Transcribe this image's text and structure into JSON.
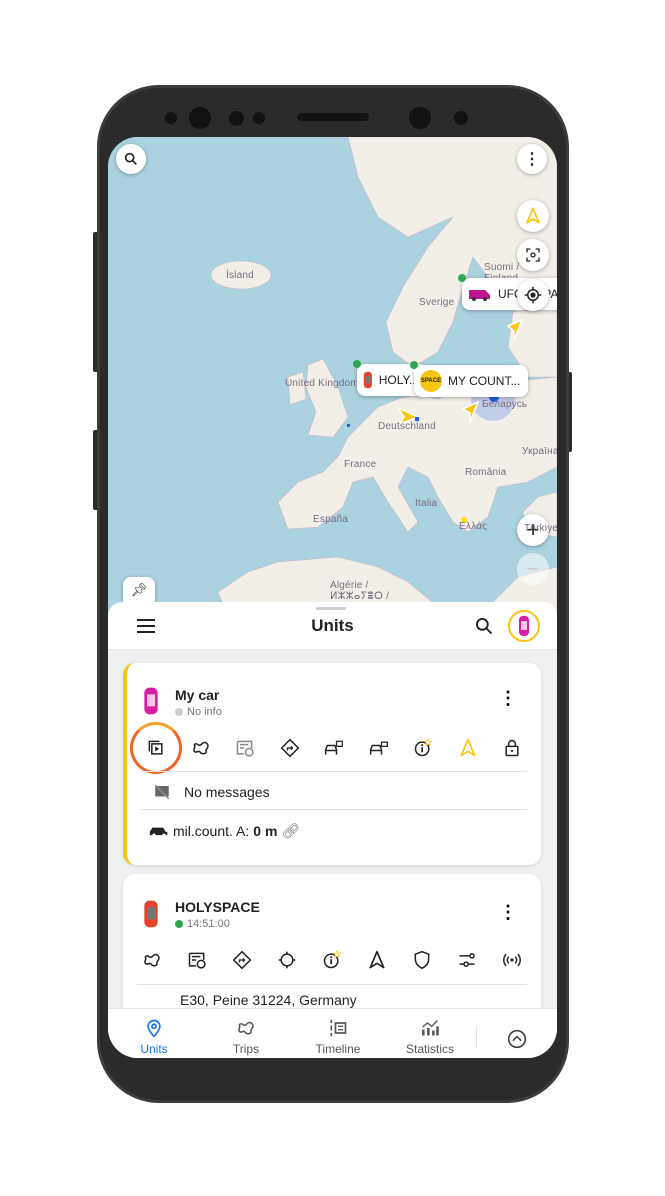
{
  "colors": {
    "accent": "#1a73e8",
    "selected_border": "#f9c513",
    "online": "#2ea84f",
    "offline": "#cccccc",
    "sea": "#aad3df",
    "land": "#f2efe9"
  },
  "map": {
    "labels": [
      "Ísland",
      "Sverige",
      "Suomi / Finland",
      "United Kingdom",
      "Deutschland",
      "Беларусь",
      "France",
      "România",
      "Україна",
      "Italia",
      "España",
      "Ελλάς",
      "Türkiye",
      "Algérie / ⵍⵣⵣⴰⵢⴻⵔ /"
    ],
    "markers": [
      {
        "name": "UFOINSPA...",
        "icon": "van-icon",
        "status": "online"
      },
      {
        "name": "HOLY...",
        "icon": "car-icon",
        "status": "online"
      },
      {
        "name": "MY COUNT...",
        "icon": "space-logo",
        "logo_text": "SPACE",
        "status": "online"
      }
    ],
    "buttons": {
      "search": "search-icon",
      "menu": "more-vert-icon",
      "navigate": "navigation-icon",
      "focus": "center-focus-icon",
      "locate": "my-location-icon",
      "zoom_in": "+",
      "zoom_out": "−",
      "pin": "pin-icon"
    }
  },
  "header": {
    "title": "Units",
    "menu_icon": "hamburger-icon",
    "search_icon": "search-icon"
  },
  "units": [
    {
      "name": "My car",
      "status": "No info",
      "status_type": "offline",
      "selected": true,
      "actions": [
        "messages-play",
        "trips",
        "reports-history",
        "route",
        "car-lock-1",
        "car-lock-2",
        "info-star",
        "navigation",
        "lock"
      ],
      "messages": "No messages",
      "counter_label": "mil.count. A:",
      "counter_value": "0 m"
    },
    {
      "name": "HOLYSPACE",
      "status": "14:51:00",
      "status_type": "online",
      "selected": false,
      "actions": [
        "trips",
        "reports-history",
        "route",
        "locate",
        "info-star",
        "navigation",
        "shield",
        "sliders",
        "signal"
      ],
      "address": "E30, Peine 31224, Germany"
    }
  ],
  "bottom_nav": {
    "items": [
      {
        "label": "Units",
        "active": true
      },
      {
        "label": "Trips"
      },
      {
        "label": "Timeline"
      },
      {
        "label": "Statistics"
      }
    ],
    "expand_icon": "chevron-up-circle-icon"
  }
}
